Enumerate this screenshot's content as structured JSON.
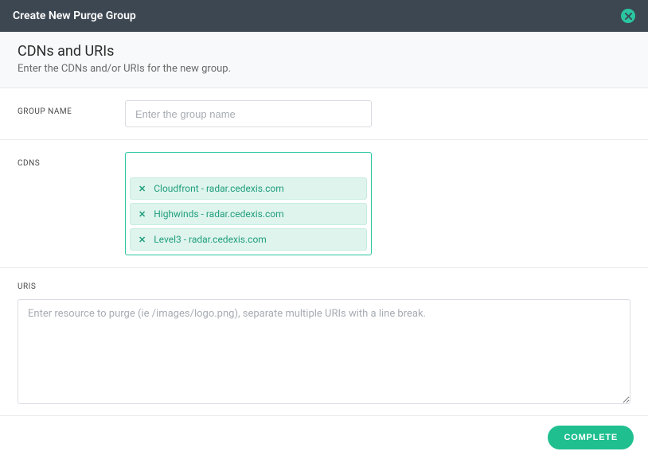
{
  "header": {
    "title": "Create New Purge Group"
  },
  "section": {
    "title": "CDNs and URIs",
    "subtitle": "Enter the CDNs and/or URIs for the new group."
  },
  "labels": {
    "group_name": "GROUP NAME",
    "cdns": "CDNS",
    "uris": "URIS"
  },
  "inputs": {
    "group_name_placeholder": "Enter the group name",
    "group_name_value": "",
    "cdns_input_value": "",
    "uris_placeholder": "Enter resource to purge (ie /images/logo.png), separate multiple URIs with a line break.",
    "uris_value": ""
  },
  "cdns": {
    "tags": [
      {
        "label": "Cloudfront - radar.cedexis.com"
      },
      {
        "label": "Highwinds - radar.cedexis.com"
      },
      {
        "label": "Level3 - radar.cedexis.com"
      }
    ]
  },
  "footer": {
    "complete_label": "COMPLETE"
  }
}
